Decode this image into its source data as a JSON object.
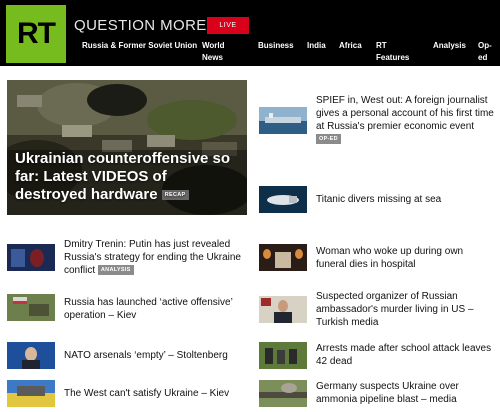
{
  "brand": {
    "logo_text": "RT",
    "tagline": "QUESTION MORE",
    "live_label": "LIVE",
    "logo_color": "#77bc1f",
    "live_color": "#d9001b"
  },
  "nav": [
    {
      "label": "Russia & Former Soviet Union"
    },
    {
      "label": "World News"
    },
    {
      "label": "Business"
    },
    {
      "label": "India"
    },
    {
      "label": "Africa"
    },
    {
      "label": "RT Features"
    },
    {
      "label": "Analysis"
    },
    {
      "label": "Op-ed"
    }
  ],
  "hero": {
    "title": "Ukrainian counteroffensive so far: Latest VIDEOS of destroyed hardware",
    "badge": "RECAP"
  },
  "right_top": [
    {
      "title": "SPIEF in, West out: A foreign journalist gives a personal account of his first time at Russia's premier economic event",
      "badge": "OP-ED"
    },
    {
      "title": "Titanic divers missing at sea"
    }
  ],
  "left_list": [
    {
      "title": "Dmitry Trenin: Putin has just revealed Russia's strategy for ending the Ukraine conflict",
      "badge": "ANALYSIS"
    },
    {
      "title": "Russia has launched ‘active offensive’ operation – Kiev"
    },
    {
      "title": "NATO arsenals ‘empty’ – Stoltenberg"
    },
    {
      "title": "The West can't satisfy Ukraine – Kiev"
    }
  ],
  "right_list": [
    {
      "title": "Woman who woke up during own funeral dies in hospital"
    },
    {
      "title": "Suspected organizer of Russian ambassador's murder living in US – Turkish media"
    },
    {
      "title": "Arrests made after school attack leaves 42 dead"
    },
    {
      "title": "Germany suspects Ukraine over ammonia pipeline blast – media"
    }
  ]
}
